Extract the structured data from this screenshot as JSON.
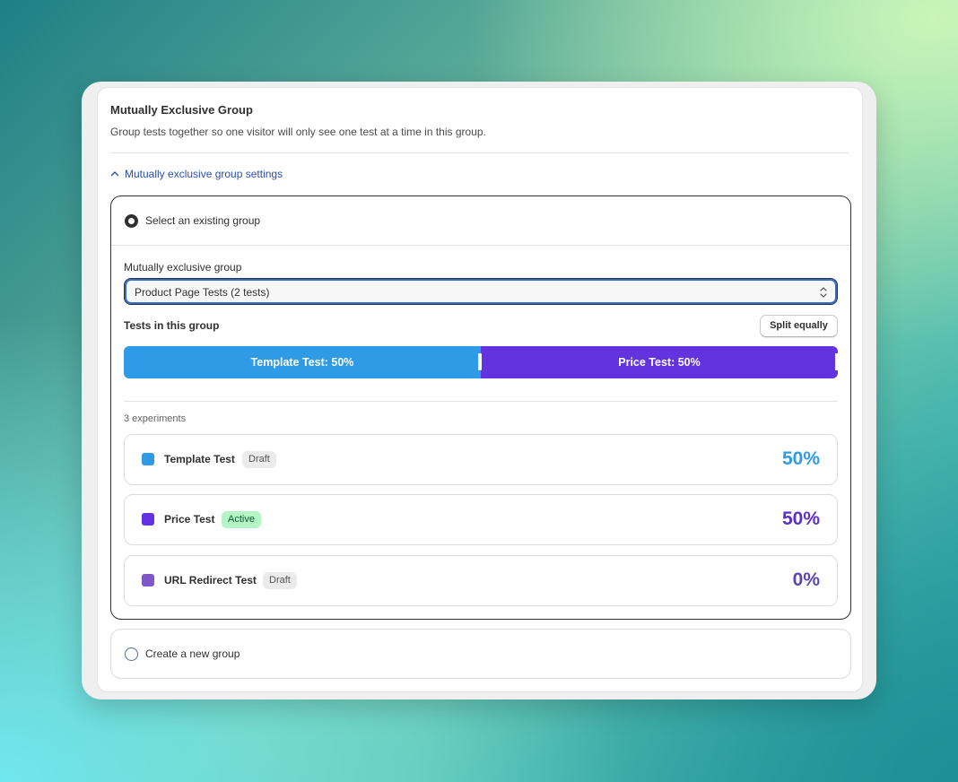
{
  "section": {
    "title": "Mutually Exclusive Group",
    "description": "Group tests together so one visitor will only see one test at a time in this group.",
    "settings_toggle_label": "Mutually exclusive group settings"
  },
  "existing_option": {
    "label": "Select an existing group",
    "selected": true,
    "field_label": "Mutually exclusive group",
    "select_value": "Product Page Tests (2 tests)",
    "tests_label": "Tests in this group",
    "split_button_label": "Split equally",
    "allocation": [
      {
        "label": "Template Test: 50%",
        "share": 0.5,
        "color": "#2f9be6"
      },
      {
        "label": "Price Test: 50%",
        "share": 0.5,
        "color": "#6433e0"
      }
    ],
    "experiments_count": "3 experiments",
    "experiments": [
      {
        "name": "Template Test",
        "status": "Draft",
        "percent": "50%",
        "color": "#2f9be6",
        "pct_color": "#2f9be6"
      },
      {
        "name": "Price Test",
        "status": "Active",
        "percent": "50%",
        "color": "#6433e0",
        "pct_color": "#5b2fc9"
      },
      {
        "name": "URL Redirect Test",
        "status": "Draft",
        "percent": "0%",
        "color": "#7e57c8",
        "pct_color": "#5b46b3"
      }
    ]
  },
  "new_option": {
    "label": "Create a new group",
    "selected": false
  }
}
